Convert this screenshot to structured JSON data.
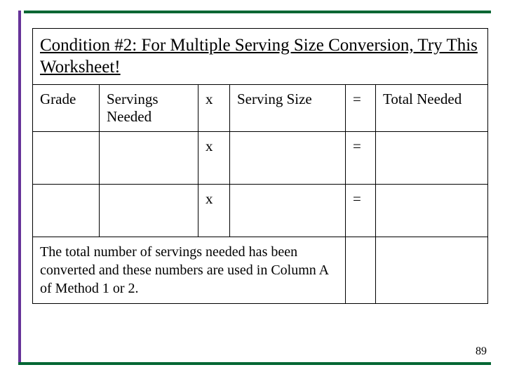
{
  "title": "Condition #2:  For Multiple Serving Size Conversion, Try This Worksheet!",
  "columns": {
    "grade": "Grade",
    "servings_needed": "Servings Needed",
    "x": "x",
    "serving_size": "Serving Size",
    "eq": "=",
    "total_needed": "Total Needed"
  },
  "rows": [
    {
      "grade": "",
      "servings_needed": "",
      "x": "x",
      "serving_size": "",
      "eq": "=",
      "total_needed": ""
    },
    {
      "grade": "",
      "servings_needed": "",
      "x": "x",
      "serving_size": "",
      "eq": "=",
      "total_needed": ""
    }
  ],
  "footnote": "The total number of servings needed has been converted and these numbers are used in Column A of Method 1 or 2.",
  "page_number": "89"
}
